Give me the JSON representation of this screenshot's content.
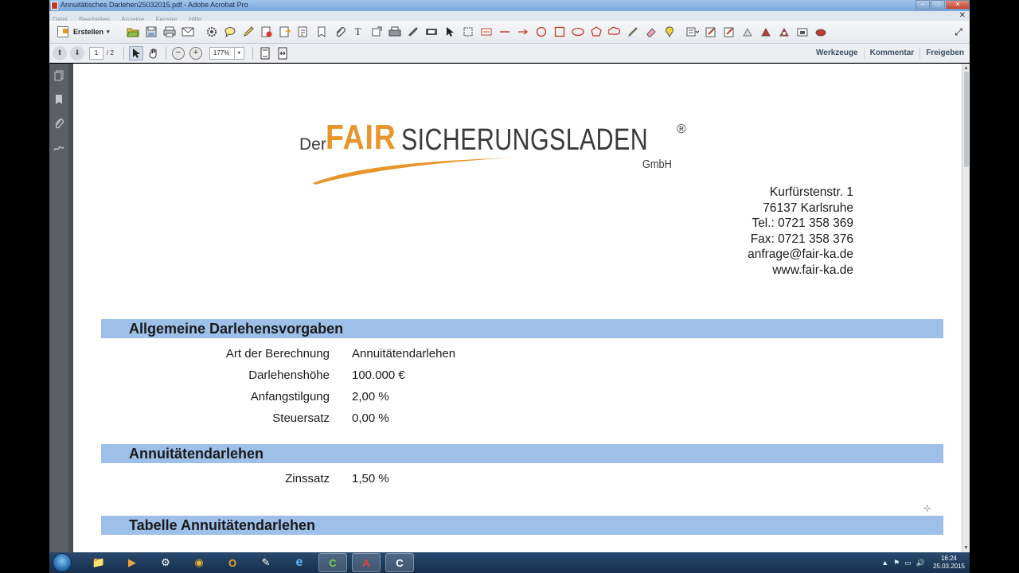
{
  "window": {
    "title": "Annuitätisches Darlehen25032015.pdf - Adobe Acrobat Pro",
    "controls": {
      "minimize": "–",
      "maximize": "□",
      "close": "✕"
    }
  },
  "menu": [
    "Datei",
    "Bearbeiten",
    "Anzeige",
    "Fenster",
    "Hilfe"
  ],
  "menu_close": "✕",
  "toolbar": {
    "create_label": "Erstellen",
    "create_caret": "▾",
    "icons": [
      "open-icon",
      "save-icon",
      "print-icon",
      "email-icon",
      "settings-icon",
      "comment-icon",
      "highlight-icon",
      "stamp-icon",
      "attach-file-icon",
      "add-text-icon",
      "paperclip-icon",
      "text-field-icon",
      "crop-icon",
      "printer-icon",
      "link-icon",
      "video-icon",
      "select-icon",
      "area-icon",
      "edit-text-icon",
      "line-icon",
      "arrow-icon",
      "circle-icon",
      "rectangle-icon",
      "oval-icon",
      "polygon-icon",
      "cloud-icon",
      "pencil-icon",
      "eraser-icon",
      "pin-icon",
      "annotations-icon",
      "sign-icon",
      "redact-icon",
      "sign2-icon",
      "redact2-icon",
      "erase-redact-icon",
      "shred-icon"
    ],
    "expand_icon": "⤢"
  },
  "navbar": {
    "prev_icon": "⬆",
    "next_icon": "⬇",
    "current_page": "1",
    "total_pages": "/ 2",
    "zoom": "177%",
    "zoom_caret": "▾",
    "zoom_out": "−",
    "zoom_in": "+",
    "panels": [
      "Werkzeuge",
      "Kommentar",
      "Freigeben"
    ]
  },
  "nav_pane_icons": [
    "pages-icon",
    "bookmark-icon",
    "attachment-icon",
    "signature-icon"
  ],
  "document": {
    "logo": {
      "der": "Der",
      "fair": "FAIR",
      "rest": "SICHERUNGSLADEN",
      "reg": "®",
      "gmbh": "GmbH"
    },
    "address": [
      "Kurfürstenstr. 1",
      "76137 Karlsruhe",
      "Tel.: 0721 358 369",
      "Fax: 0721 358 376",
      "anfrage@fair-ka.de",
      "www.fair-ka.de"
    ],
    "section1": {
      "title": "Allgemeine Darlehensvorgaben",
      "rows": [
        {
          "label": "Art der Berechnung",
          "value": "Annuitätendarlehen"
        },
        {
          "label": "Darlehenshöhe",
          "value": "100.000 €"
        },
        {
          "label": "Anfangstilgung",
          "value": "2,00 %"
        },
        {
          "label": "Steuersatz",
          "value": "0,00 %"
        }
      ]
    },
    "section2": {
      "title": "Annuitätendarlehen",
      "rows": [
        {
          "label": "Zinssatz",
          "value": "1,50 %"
        }
      ]
    },
    "section3": {
      "title": "Tabelle Annuitätendarlehen"
    },
    "colors": {
      "section_bar": "#9dbfe8",
      "logo_orange": "#e8962a"
    }
  },
  "taskbar": {
    "apps": [
      {
        "name": "file-explorer-icon",
        "glyph": "📁"
      },
      {
        "name": "media-player-icon",
        "glyph": "▶"
      },
      {
        "name": "control-panel-icon",
        "glyph": "⚙"
      },
      {
        "name": "chrome-icon",
        "glyph": "◉"
      },
      {
        "name": "outlook-icon",
        "glyph": "O"
      },
      {
        "name": "tool-icon",
        "glyph": "✎"
      },
      {
        "name": "internet-explorer-icon",
        "glyph": "e"
      },
      {
        "name": "camtasia-icon",
        "glyph": "C"
      },
      {
        "name": "acrobat-icon",
        "glyph": "A"
      },
      {
        "name": "camtasia-recorder-icon",
        "glyph": "C"
      }
    ],
    "tray_icons": [
      "▲",
      "⚑",
      "▭",
      "🔊"
    ],
    "time": "16:24",
    "date": "25.03.2015"
  }
}
